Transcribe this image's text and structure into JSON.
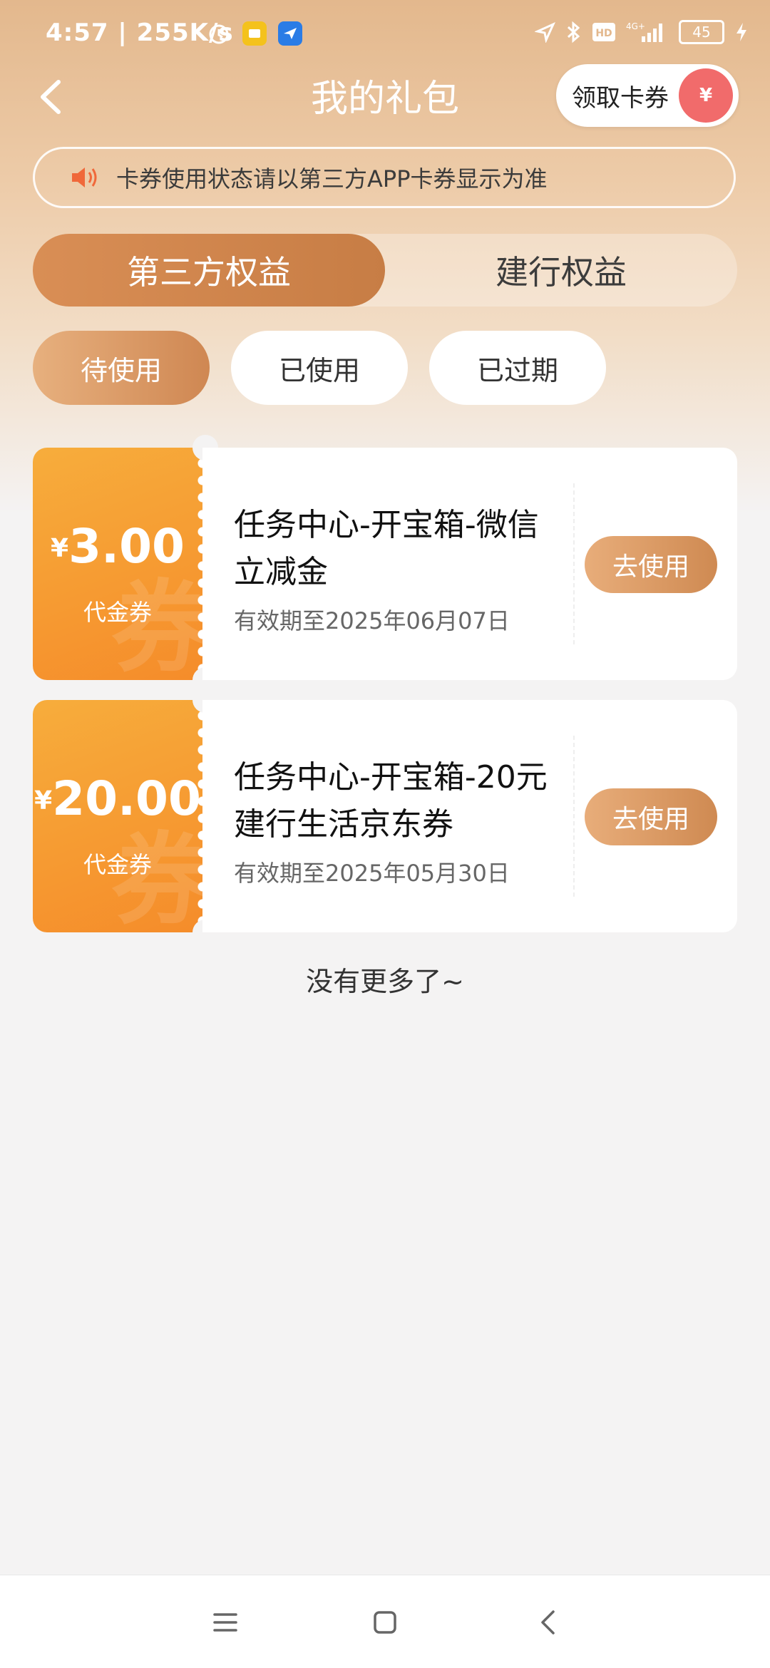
{
  "status_bar": {
    "time": "4:57 | 255K/s",
    "battery": "45"
  },
  "header": {
    "title": "我的礼包",
    "claim_label": "领取卡券",
    "claim_icon_text": "¥"
  },
  "notice": {
    "text": "卡券使用状态请以第三方APP卡券显示为准"
  },
  "main_tabs": [
    {
      "label": "第三方权益",
      "active": true
    },
    {
      "label": "建行权益",
      "active": false
    }
  ],
  "sub_tabs": [
    {
      "label": "待使用",
      "active": true
    },
    {
      "label": "已使用",
      "active": false
    },
    {
      "label": "已过期",
      "active": false
    }
  ],
  "coupons": [
    {
      "currency": "¥",
      "amount": "3.00",
      "kind": "代金券",
      "watermark": "券",
      "name": "任务中心-开宝箱-微信立减金",
      "expiry": "有效期至2025年06月07日",
      "button": "去使用"
    },
    {
      "currency": "¥",
      "amount": "20.00",
      "kind": "代金券",
      "watermark": "券",
      "name": "任务中心-开宝箱-20元建行生活京东券",
      "expiry": "有效期至2025年05月30日",
      "button": "去使用"
    }
  ],
  "footer": {
    "no_more": "没有更多了~"
  },
  "colors": {
    "accent": "#cf8a52",
    "coupon_orange": "#f58c2a",
    "background": "#f4f3f3"
  }
}
